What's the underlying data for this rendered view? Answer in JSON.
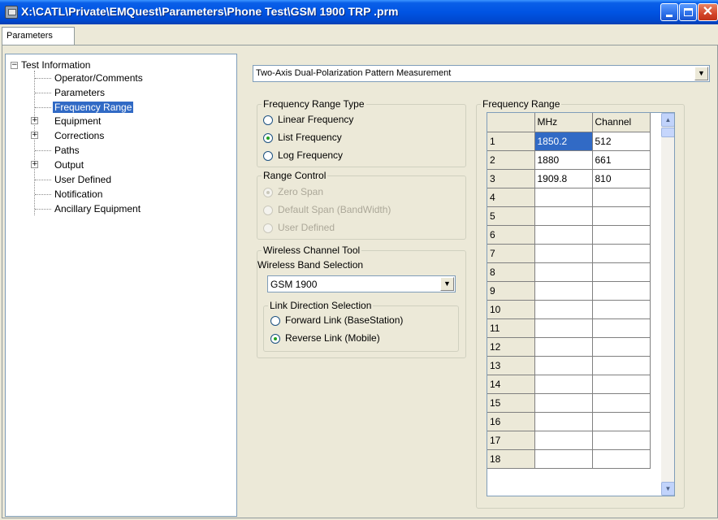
{
  "window": {
    "title": "X:\\CATL\\Private\\EMQuest\\Parameters\\Phone Test\\GSM 1900 TRP .prm"
  },
  "tabs": [
    {
      "label": "Parameters"
    }
  ],
  "tree": {
    "root": "Test Information",
    "items": [
      {
        "label": "Operator/Comments"
      },
      {
        "label": "Parameters"
      },
      {
        "label": "Frequency Range",
        "selected": true
      },
      {
        "label": "Equipment",
        "expandable": true
      },
      {
        "label": "Corrections",
        "expandable": true
      },
      {
        "label": "Paths"
      },
      {
        "label": "Output",
        "expandable": true
      },
      {
        "label": "User Defined"
      },
      {
        "label": "Notification"
      },
      {
        "label": "Ancillary Equipment"
      }
    ]
  },
  "measurement_type": {
    "value": "Two-Axis Dual-Polarization Pattern Measurement"
  },
  "frequency_range_type": {
    "title": "Frequency Range Type",
    "options": [
      {
        "label": "Linear Frequency",
        "checked": false
      },
      {
        "label": "List Frequency",
        "checked": true
      },
      {
        "label": "Log Frequency",
        "checked": false
      }
    ]
  },
  "range_control": {
    "title": "Range Control",
    "options": [
      {
        "label": "Zero Span",
        "checked": true
      },
      {
        "label": "Default Span (BandWidth)",
        "checked": false
      },
      {
        "label": "User Defined",
        "checked": false
      }
    ]
  },
  "wireless_channel_tool": {
    "title": "Wireless Channel Tool",
    "band_label": "Wireless Band Selection",
    "band_value": "GSM 1900",
    "link_direction": {
      "title": "Link Direction Selection",
      "options": [
        {
          "label": "Forward Link (BaseStation)",
          "checked": false
        },
        {
          "label": "Reverse Link (Mobile)",
          "checked": true
        }
      ]
    }
  },
  "frequency_range": {
    "title": "Frequency Range",
    "columns": [
      "MHz",
      "Channel"
    ],
    "rows": [
      {
        "n": "1",
        "mhz": "1850.2",
        "channel": "512"
      },
      {
        "n": "2",
        "mhz": "1880",
        "channel": "661"
      },
      {
        "n": "3",
        "mhz": "1909.8",
        "channel": "810"
      },
      {
        "n": "4",
        "mhz": "",
        "channel": ""
      },
      {
        "n": "5",
        "mhz": "",
        "channel": ""
      },
      {
        "n": "6",
        "mhz": "",
        "channel": ""
      },
      {
        "n": "7",
        "mhz": "",
        "channel": ""
      },
      {
        "n": "8",
        "mhz": "",
        "channel": ""
      },
      {
        "n": "9",
        "mhz": "",
        "channel": ""
      },
      {
        "n": "10",
        "mhz": "",
        "channel": ""
      },
      {
        "n": "11",
        "mhz": "",
        "channel": ""
      },
      {
        "n": "12",
        "mhz": "",
        "channel": ""
      },
      {
        "n": "13",
        "mhz": "",
        "channel": ""
      },
      {
        "n": "14",
        "mhz": "",
        "channel": ""
      },
      {
        "n": "15",
        "mhz": "",
        "channel": ""
      },
      {
        "n": "16",
        "mhz": "",
        "channel": ""
      },
      {
        "n": "17",
        "mhz": "",
        "channel": ""
      },
      {
        "n": "18",
        "mhz": "",
        "channel": ""
      }
    ]
  }
}
